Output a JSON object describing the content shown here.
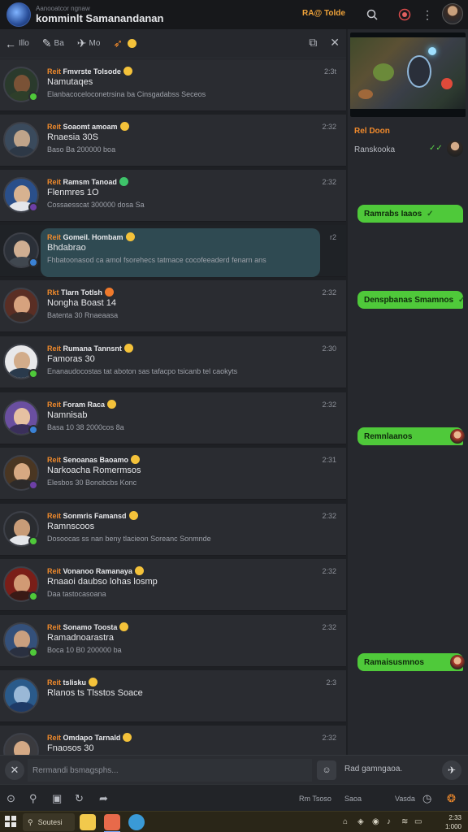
{
  "app": {
    "subtitle": "Aanooatcor ngnaw",
    "title": "komminlt Samanandanan",
    "status_text": "RA@ Tolde"
  },
  "titlebar_icons": [
    "search-icon",
    "record-icon",
    "more-icon"
  ],
  "list_header": {
    "back_label": "Illo",
    "item2_label": "Ba",
    "item3_label": "Mo",
    "item4_label": ""
  },
  "chats": [
    {
      "tag": "Reit",
      "name": "Fmvrste Tolsode",
      "line2": "Namutaqes",
      "line3": "Elanbacoceloconetrsina ba Cinsgadabss Seceos",
      "time": "2:3t",
      "avatar": "#2a3a2c",
      "face": "#7a5236",
      "body": "#2e3f2a",
      "dot": "#4fc93a",
      "emoji": "#f4c23a"
    },
    {
      "tag": "Reit",
      "name": "Soaomt amoam",
      "line2": "Rnaesia 30S",
      "line3": "Baso Ba 200000 boa",
      "time": "2:32",
      "avatar": "#3a4a5c",
      "face": "#bfa48a",
      "body": "#2d3846",
      "dot": "",
      "emoji": "#f4c23a"
    },
    {
      "tag": "Reit",
      "name": "Ramsm Tanoad",
      "line2": "Flenmres 1O",
      "line3": "Cossaesscat 300000 dosa  Sa",
      "time": "2:32",
      "avatar": "#2a4f8a",
      "face": "#d7b290",
      "body": "#e4e6ea",
      "dot": "#6d3fa6",
      "emoji": "#3ec46a"
    },
    {
      "tag": "Reit",
      "name": "Gomeil. Hombam",
      "line2": "Bhdabrao",
      "line3": "Fhbatoonasod ca amol fsorehecs tatmace cocofeeaderd fenarn ans",
      "time": "r2",
      "avatar": "#2b3038",
      "face": "#cfae92",
      "body": "#40474f",
      "dot": "#3a82d6",
      "emoji": "#f4c23a",
      "active": true
    },
    {
      "tag": "Rkt",
      "name": "Tlarn Totlsh",
      "line2": "Nongha Boast 14",
      "line3": "Batenta 30 Rnaeaasa",
      "time": "2:32",
      "avatar": "#5a2e24",
      "face": "#d6a27e",
      "body": "#3a2c28",
      "dot": "",
      "emoji": "#f07a2c"
    },
    {
      "tag": "Reit",
      "name": "Rumana Tannsnt",
      "line2": "Famoras 30",
      "line3": "Enanaudocostas tat aboton sas tafacpo tsicanb tel caokyts",
      "time": "2:30",
      "avatar": "#e8e8ea",
      "face": "#d2ac8a",
      "body": "#2a3a4c",
      "dot": "#4fc93a",
      "emoji": "#f4c23a"
    },
    {
      "tag": "Reit",
      "name": "Foram Raca",
      "line2": "Namnisab",
      "line3": "Basa 10 38 2000cos 8a",
      "time": "2:32",
      "avatar": "#6a4fa0",
      "face": "#e6c1a2",
      "body": "#3a2f5a",
      "dot": "#3a82d6",
      "emoji": "#f4c23a"
    },
    {
      "tag": "Reit",
      "name": "Senoanas Baoamo",
      "line2": "Narkoacha Romermsos",
      "line3": "Elesbos 30 Bonobcbs Konc",
      "time": "2:31",
      "avatar": "#4a3622",
      "face": "#d7a982",
      "body": "#2c2a2a",
      "dot": "#6d3fa6",
      "emoji": "#f4c23a"
    },
    {
      "tag": "Reit",
      "name": "Sonmris Famansd",
      "line2": "Ramnscoos",
      "line3": "Dosoocas ss nan beny tlacieon Soreanc Sonmnde",
      "time": "2:32",
      "avatar": "#2a2c30",
      "face": "#c89c78",
      "body": "#e4e6ea",
      "dot": "#4fc93a",
      "emoji": "#f4c23a"
    },
    {
      "tag": "Reit",
      "name": "Vonanoo Ramanaya",
      "line2": "Rnaaoi daubso lohas losmp",
      "line3": "Daa tastocasoana",
      "time": "2:32",
      "avatar": "#7a1e18",
      "face": "#d19a74",
      "body": "#3a1a16",
      "dot": "#4fc93a",
      "emoji": "#f4c23a"
    },
    {
      "tag": "Reit",
      "name": "Sonamo Toosta",
      "line2": "Ramadnoarastra",
      "line3": "Boca 10 B0 200000 ba",
      "time": "2:32",
      "avatar": "#34507a",
      "face": "#c99f7f",
      "body": "#2a3040",
      "dot": "#4fc93a",
      "emoji": "#f4c23a"
    },
    {
      "tag": "Reit",
      "name": "tslisku",
      "line2": "Rlanos ts Tlsstos Soace",
      "line3": "",
      "time": "2:3",
      "avatar": "#2a5a8a",
      "face": "#9ab8d6",
      "body": "#1e3a66",
      "dot": "",
      "emoji": "#f4c23a"
    },
    {
      "tag": "Reit",
      "name": "Omdapo Tarnald",
      "line2": "Fnaosos 30",
      "line3": "",
      "time": "2:32",
      "avatar": "#3a3a3e",
      "face": "#d4a985",
      "body": "#2a2a2e",
      "dot": "",
      "emoji": "#f4c23a"
    }
  ],
  "right_pane": {
    "label": "Rel Doon",
    "sub": "Ranskooka",
    "bubbles": [
      {
        "text": "Ramrabs Iaaos",
        "check": true,
        "avatar": false
      },
      {
        "text": "Denspbanas   Smamnos",
        "check": true,
        "avatar": false
      },
      {
        "text": "Remnlaanos",
        "check": false,
        "avatar": true
      },
      {
        "text": "Ramaisusmnos",
        "check": false,
        "avatar": true
      }
    ]
  },
  "composer": {
    "placeholder": "Rermandi bsmagsphs...",
    "right_text": "Rad gamngaoa."
  },
  "bottom_bar": {
    "text1": "Rm Tsoso",
    "text2": "Saoa",
    "text3": "Vasda"
  },
  "taskbar": {
    "search_label": "Soutesi",
    "clock_time": "2:33",
    "clock_date": "1:000"
  }
}
